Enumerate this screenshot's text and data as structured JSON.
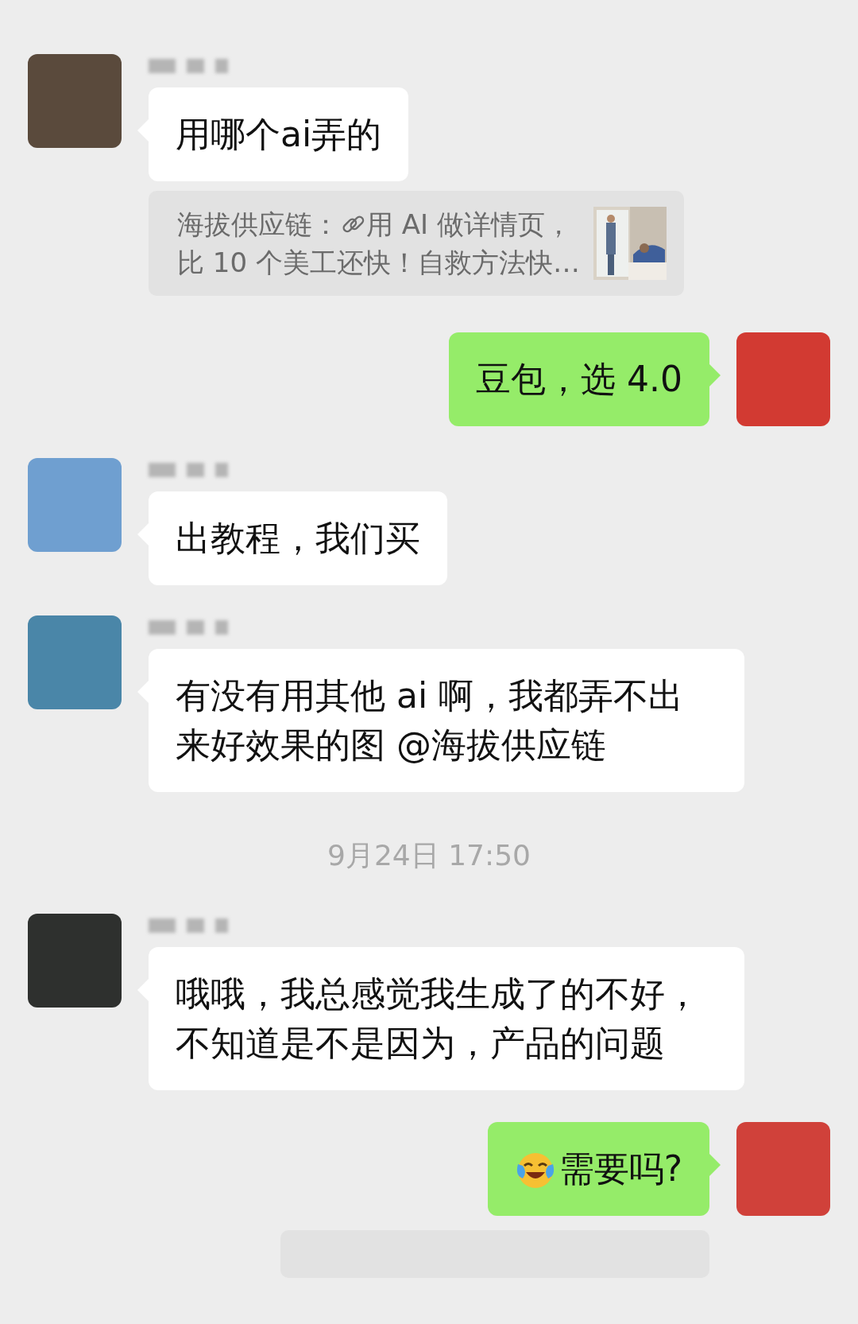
{
  "messages": [
    {
      "kind": "incoming",
      "name_redacted": true,
      "color": "#5a4a3c",
      "text": "用哪个ai弄的",
      "quote": {
        "sender": "海拔供应链：",
        "text_lines": [
          "用 AI 做详情页，",
          "比 10 个美工还快！自救方法快…"
        ],
        "has_thumbnail": true
      }
    },
    {
      "kind": "outgoing",
      "color": "#d23a32",
      "text": "豆包，选 4.0"
    },
    {
      "kind": "incoming",
      "name_redacted": true,
      "color": "#6f9fd0",
      "text": "出教程，我们买"
    },
    {
      "kind": "incoming",
      "name_redacted": true,
      "color": "#4a86a8",
      "text": "有没有用其他 ai 啊，我都弄不出来好效果的图 @海拔供应链"
    },
    {
      "kind": "time",
      "text": "9月24日 17:50"
    },
    {
      "kind": "incoming",
      "name_redacted": true,
      "color": "#2e302e",
      "text": "哦哦，我总感觉我生成了的不好，不知道是不是因为，产品的问题"
    },
    {
      "kind": "outgoing",
      "color": "#d0413a",
      "has_emoji": true,
      "text": "需要吗?",
      "quote": {
        "kind": "cut"
      }
    }
  ]
}
